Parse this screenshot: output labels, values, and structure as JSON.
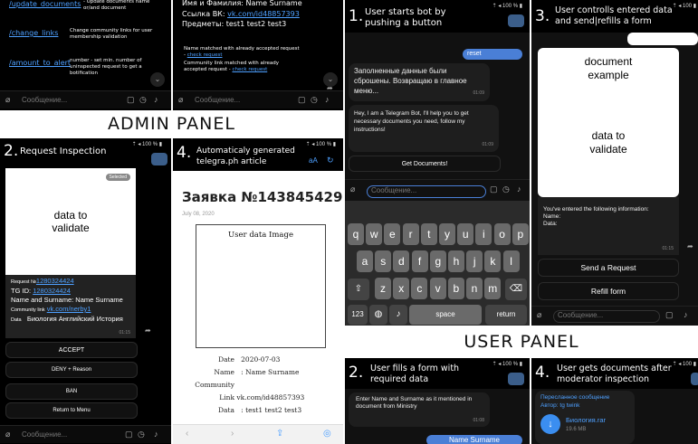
{
  "admin": {
    "banner": "ADMIN PANEL",
    "commands": [
      {
        "cmd": "/update_documents",
        "desc": "- Update documents name or/and document"
      },
      {
        "cmd": "/change_links",
        "desc": "Change community links for user membership validation"
      },
      {
        "cmd": "/amount_to_alert",
        "desc": "number - set min. number of uninspected request to get a botification"
      }
    ],
    "profile": {
      "line1": "Имя и Фамилия: Name Surname",
      "link_label": "Ссылка ВК:",
      "link": "vk.com/id48857393",
      "subjects": "Предметы: test1 test2 test3",
      "note1": "Name matched with already accepted request -",
      "note1_link": "check request",
      "note2": "Community link matched with already accepted request -",
      "note2_link": "check request"
    },
    "placeholder": "Сообщение...",
    "step2": {
      "num": "2.",
      "title": "Request Inspection",
      "badge": "Selected",
      "image_text": "data to validate",
      "request_label": "Request №",
      "request_id": "1280324424",
      "tg_label": "TG ID:",
      "tg_id": "1280324424",
      "name_line": "Name and Surname: Name Surname",
      "community_label": "Community link",
      "community": "vk.com/nerby1",
      "data_label": "Data",
      "data_value": "Биология Английский История",
      "time": "01:15",
      "buttons": [
        "ACCEPT",
        "DENY + Reason",
        "BAN",
        "Return to Menu"
      ]
    },
    "step4": {
      "num": "4.",
      "title": "Automaticaly generated telegra.ph article",
      "article_title": "Заявка №143845429",
      "date": "July 08, 2020",
      "image_label": "User data Image",
      "fields": [
        {
          "k": "Date",
          "v": "2020-07-03"
        },
        {
          "k": "Name",
          "v": ": Name Surname"
        },
        {
          "k": "Community Link",
          "v": "vk.com/id48857393"
        },
        {
          "k": "Data",
          "v": ": test1 test2 test3"
        }
      ]
    }
  },
  "user": {
    "banner": "USER PANEL",
    "step1": {
      "num": "1.",
      "title": "User starts bot by pushing a button",
      "reset": "reset",
      "msg1": "Заполненные данные были сброшены. Возвращаю в главное меню...",
      "msg1_time": "01:09",
      "msg2": "Hey, I am a Telegram Bot, I'll help you to get necessary documents you need, follow my instructions!",
      "msg2_time": "01:09",
      "button": "Get Documents!",
      "placeholder": "Сообщение...",
      "rows": [
        [
          "q",
          "w",
          "e",
          "r",
          "t",
          "y",
          "u",
          "i",
          "o",
          "p"
        ],
        [
          "a",
          "s",
          "d",
          "f",
          "g",
          "h",
          "j",
          "k",
          "l"
        ],
        [
          "z",
          "x",
          "c",
          "v",
          "b",
          "n",
          "m"
        ]
      ],
      "k123": "123",
      "space": "space",
      "ret": "return"
    },
    "step3": {
      "num": "3.",
      "title": "User controlls entered data and send|refills a form",
      "doc_title": "document example",
      "doc_text": "data to validate",
      "info": "You've entered the following information:",
      "info_name": "Name:",
      "info_data": "Data:",
      "time": "01:15",
      "buttons": [
        "Send a Request",
        "Refill form"
      ],
      "placeholder": "Сообщение..."
    },
    "step2": {
      "num": "2.",
      "title": "User fills a form with required data",
      "msg": "Enter Name and Surname as it mentioned in document from Ministry",
      "time": "01:08",
      "reply": "Name Surname"
    },
    "step4": {
      "num": "4.",
      "title": "User gets documents after moderator inspection",
      "fwd": "Пересланное сообщение",
      "author": "Автор: tg twink",
      "file": "Биология.rar",
      "size": "19.6 MB"
    }
  }
}
